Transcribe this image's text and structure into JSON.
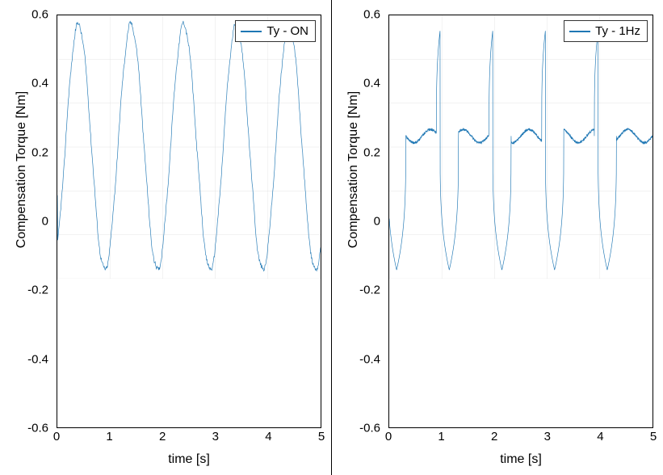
{
  "chart_data": [
    {
      "type": "line",
      "xlabel": "time [s]",
      "ylabel": "Compensation Torque [Nm]",
      "xlim": [
        0,
        5
      ],
      "ylim": [
        -0.6,
        0.6
      ],
      "xticks": [
        0,
        1,
        2,
        3,
        4,
        5
      ],
      "yticks": [
        -0.6,
        -0.4,
        -0.2,
        0,
        0.2,
        0.4,
        0.6
      ],
      "series": [
        {
          "name": "Ty - ON",
          "color": "#1f77b4",
          "shape": "sine",
          "cycles": 5,
          "amplitude": 0.56,
          "offset": 0.0,
          "phase_frac": -0.15,
          "jitter": 0.02,
          "start_y": -0.22
        }
      ]
    },
    {
      "type": "line",
      "xlabel": "time [s]",
      "ylabel": "Compensation Torque [Nm]",
      "xlim": [
        0,
        5
      ],
      "ylim": [
        -0.6,
        0.6
      ],
      "xticks": [
        0,
        1,
        2,
        3,
        4,
        5
      ],
      "yticks": [
        -0.6,
        -0.4,
        -0.2,
        0,
        0.2,
        0.4,
        0.6
      ],
      "series": [
        {
          "name": "Ty - 1Hz",
          "color": "#1f77b4",
          "shape": "spikes",
          "pulses": 5,
          "baseline": 0.05,
          "spike_high": 0.62,
          "spike_low": -0.56,
          "ripple": 0.03
        }
      ]
    }
  ]
}
